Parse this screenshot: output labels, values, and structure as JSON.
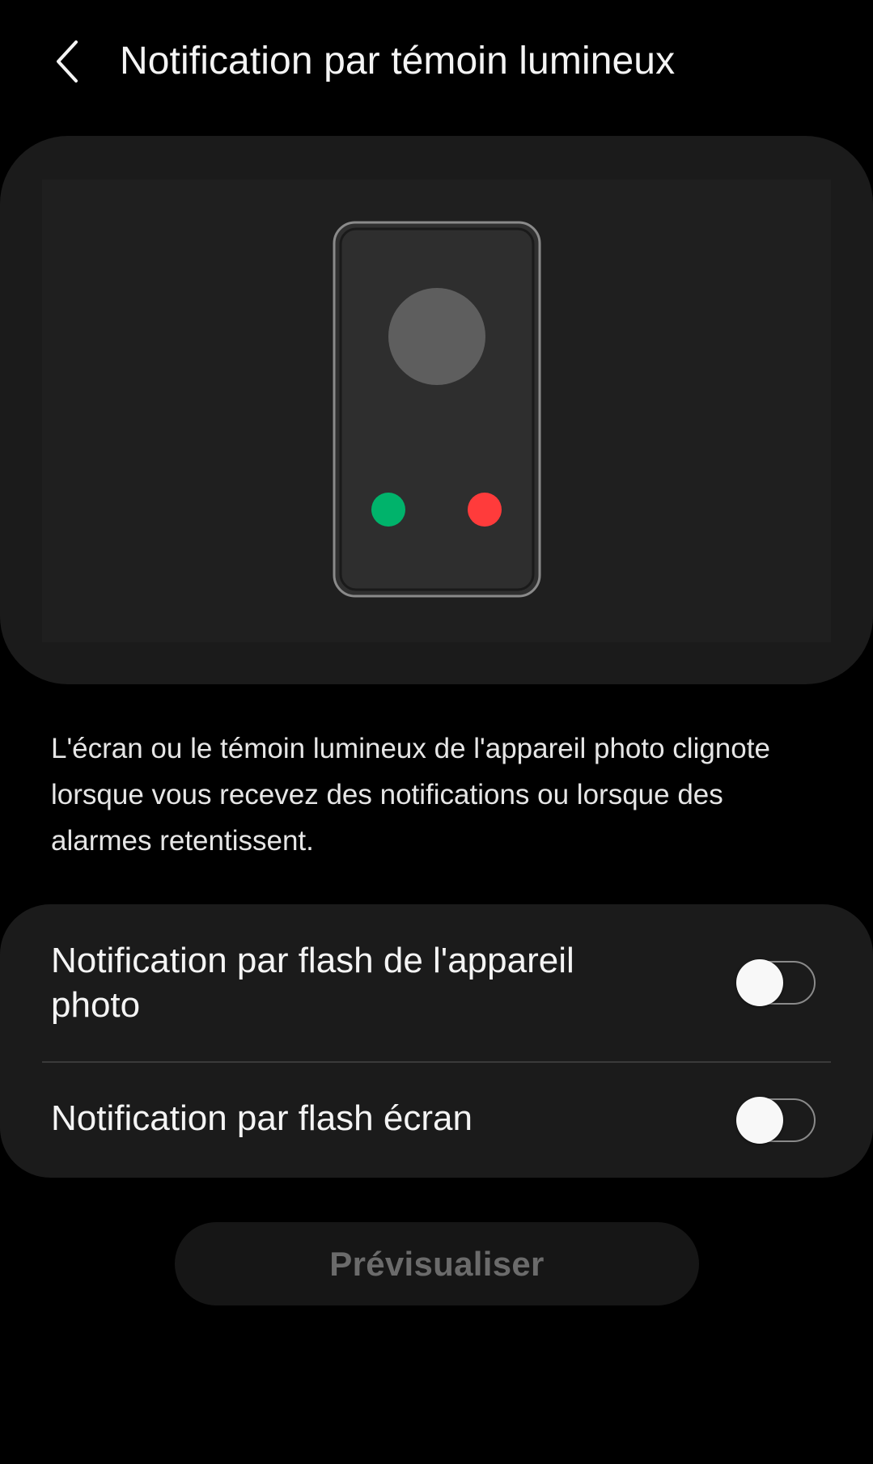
{
  "header": {
    "back_icon": "chevron-left-icon",
    "title": "Notification par témoin lumineux"
  },
  "illustration": {
    "icon": "phone-illustration",
    "indicator_colors": {
      "left_dot": "#00b36b",
      "right_dot": "#ff3b3b"
    }
  },
  "description": "L'écran ou le témoin lumineux de l'appareil photo clignote lorsque vous recevez des notifications ou lorsque des alarmes retentissent.",
  "settings": [
    {
      "label": "Notification par flash de l'appareil photo",
      "enabled": false
    },
    {
      "label": "Notification par flash écran",
      "enabled": false
    }
  ],
  "preview_button": {
    "label": "Prévisualiser",
    "disabled": true
  },
  "colors": {
    "background": "#000000",
    "card": "#1b1b1b",
    "text_primary": "#f4f4f4",
    "text_disabled": "#6b6b6b"
  }
}
